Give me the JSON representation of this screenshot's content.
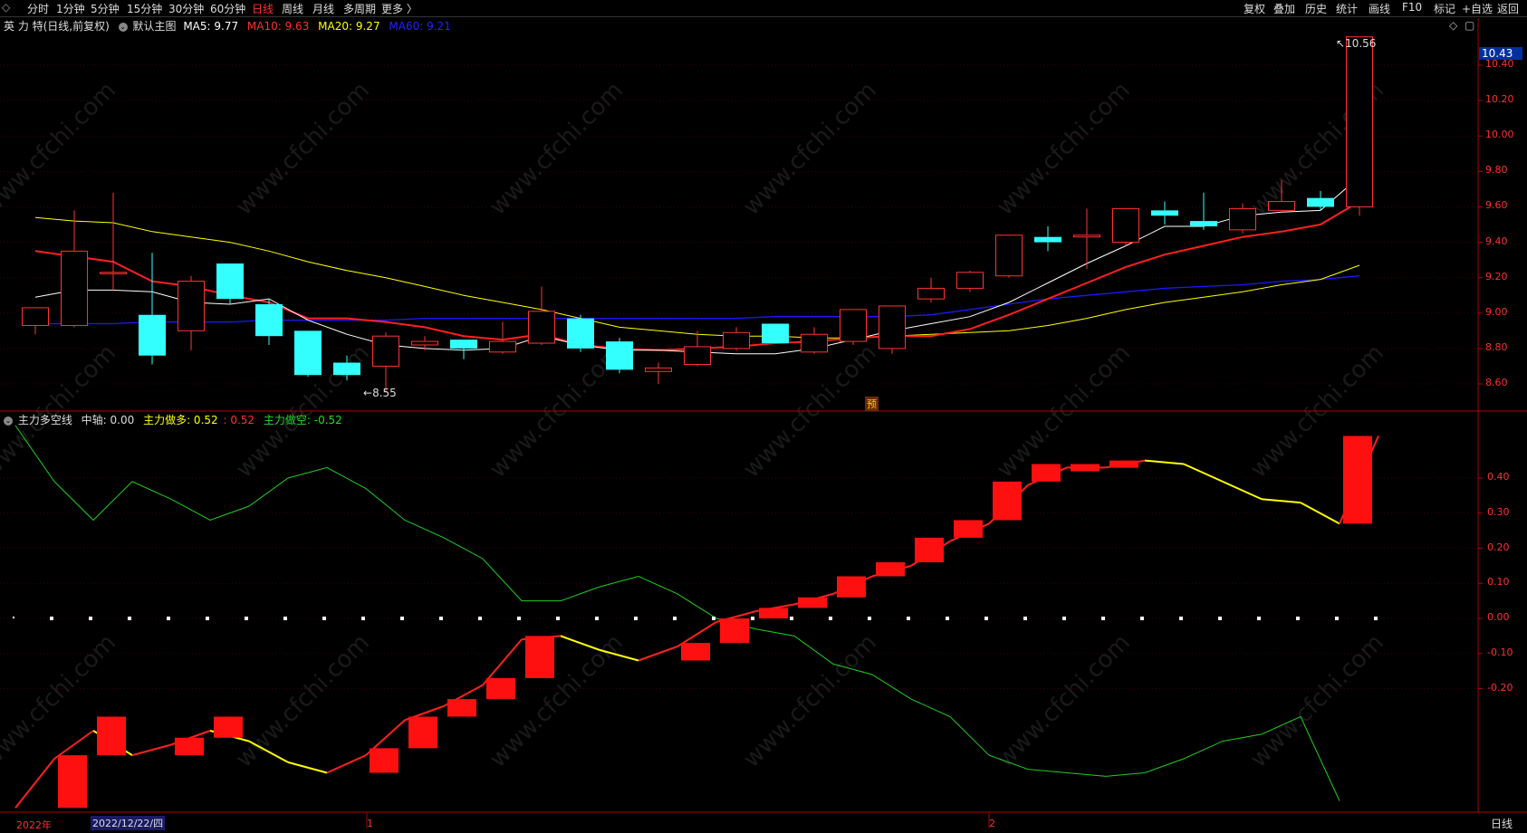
{
  "toolbar": {
    "periods": [
      "分时",
      "1分钟",
      "5分钟",
      "15分钟",
      "30分钟",
      "60分钟",
      "日线",
      "周线",
      "月线",
      "多周期",
      "更多 〉"
    ],
    "active_period": "日线",
    "right_buttons": [
      "复权",
      "叠加",
      "历史",
      "统计",
      "画线",
      "F10",
      "标记",
      "+自选",
      "返回"
    ]
  },
  "colors": {
    "up": "#ff3333",
    "down": "#33ffff",
    "ma5": "#ffffff",
    "ma10": "#ff2020",
    "ma20": "#ffff00",
    "ma60": "#1a1aff",
    "axis": "#b00000",
    "grid": "#3a0000"
  },
  "main_legend": {
    "title": "英 力 特(日线,前复权)",
    "main_label": "默认主图",
    "ma5": "MA5: 9.77",
    "ma10": "MA10: 9.63",
    "ma20": "MA20: 9.27",
    "ma60": "MA60: 9.21"
  },
  "sub_legend": {
    "title": "主力多空线",
    "mid": "中轴: 0.00",
    "long": "主力做多: 0.52",
    "sep": ": 0.52",
    "short": "主力做空: -0.52"
  },
  "price_axis": {
    "ticks": [
      "10.40",
      "10.20",
      "10.00",
      "9.80",
      "9.60",
      "9.40",
      "9.20",
      "9.00",
      "8.80",
      "8.60"
    ],
    "current": "10.43"
  },
  "sub_axis": {
    "ticks": [
      "0.40",
      "0.30",
      "0.20",
      "0.10",
      "0.00",
      "-0.10",
      "-0.20"
    ]
  },
  "date_axis": {
    "labels": [
      "2022年",
      "2022/12/22/四",
      "1",
      "2"
    ],
    "period_label": "日线"
  },
  "annotations": {
    "max_label": "10.56",
    "min_label": "8.55",
    "pre_badge": "预"
  },
  "watermark": "www.cfchi.com",
  "chart_data": [
    {
      "type": "candlestick",
      "title": "英 力 特(日线,前复权)",
      "ylim": [
        8.47,
        10.63
      ],
      "candles": [
        {
          "o": 8.93,
          "h": 9.03,
          "l": 8.88,
          "c": 9.03
        },
        {
          "o": 8.93,
          "h": 9.58,
          "l": 8.92,
          "c": 9.35
        },
        {
          "o": 9.23,
          "h": 9.68,
          "l": 9.13,
          "c": 9.23
        },
        {
          "o": 8.99,
          "h": 9.34,
          "l": 8.71,
          "c": 8.76
        },
        {
          "o": 8.9,
          "h": 9.21,
          "l": 8.79,
          "c": 9.18
        },
        {
          "o": 9.28,
          "h": 9.28,
          "l": 9.05,
          "c": 9.08
        },
        {
          "o": 9.05,
          "h": 9.08,
          "l": 8.82,
          "c": 8.87
        },
        {
          "o": 8.9,
          "h": 8.9,
          "l": 8.64,
          "c": 8.65
        },
        {
          "o": 8.72,
          "h": 8.76,
          "l": 8.62,
          "c": 8.65
        },
        {
          "o": 8.7,
          "h": 8.89,
          "l": 8.55,
          "c": 8.87
        },
        {
          "o": 8.82,
          "h": 8.87,
          "l": 8.79,
          "c": 8.84
        },
        {
          "o": 8.85,
          "h": 8.85,
          "l": 8.74,
          "c": 8.8
        },
        {
          "o": 8.78,
          "h": 8.95,
          "l": 8.77,
          "c": 8.84
        },
        {
          "o": 8.83,
          "h": 9.15,
          "l": 8.82,
          "c": 9.01
        },
        {
          "o": 8.97,
          "h": 8.99,
          "l": 8.78,
          "c": 8.8
        },
        {
          "o": 8.84,
          "h": 8.86,
          "l": 8.66,
          "c": 8.68
        },
        {
          "o": 8.67,
          "h": 8.72,
          "l": 8.6,
          "c": 8.69
        },
        {
          "o": 8.71,
          "h": 8.9,
          "l": 8.7,
          "c": 8.81
        },
        {
          "o": 8.8,
          "h": 8.92,
          "l": 8.79,
          "c": 8.89
        },
        {
          "o": 8.94,
          "h": 8.94,
          "l": 8.83,
          "c": 8.83
        },
        {
          "o": 8.78,
          "h": 8.92,
          "l": 8.77,
          "c": 8.88
        },
        {
          "o": 8.84,
          "h": 9.02,
          "l": 8.82,
          "c": 9.02
        },
        {
          "o": 8.8,
          "h": 9.04,
          "l": 8.77,
          "c": 9.04
        },
        {
          "o": 9.08,
          "h": 9.2,
          "l": 9.06,
          "c": 9.14
        },
        {
          "o": 9.14,
          "h": 9.24,
          "l": 9.12,
          "c": 9.23
        },
        {
          "o": 9.21,
          "h": 9.44,
          "l": 9.2,
          "c": 9.44
        },
        {
          "o": 9.43,
          "h": 9.49,
          "l": 9.35,
          "c": 9.4
        },
        {
          "o": 9.43,
          "h": 9.59,
          "l": 9.25,
          "c": 9.44
        },
        {
          "o": 9.4,
          "h": 9.59,
          "l": 9.38,
          "c": 9.59
        },
        {
          "o": 9.58,
          "h": 9.63,
          "l": 9.5,
          "c": 9.55
        },
        {
          "o": 9.52,
          "h": 9.68,
          "l": 9.47,
          "c": 9.49
        },
        {
          "o": 9.47,
          "h": 9.62,
          "l": 9.45,
          "c": 9.59
        },
        {
          "o": 9.58,
          "h": 9.75,
          "l": 9.57,
          "c": 9.63
        },
        {
          "o": 9.65,
          "h": 9.69,
          "l": 9.58,
          "c": 9.6
        },
        {
          "o": 9.6,
          "h": 10.56,
          "l": 9.55,
          "c": 10.56
        }
      ],
      "ma5": [
        9.09,
        9.13,
        9.13,
        9.12,
        9.06,
        9.05,
        9.08,
        8.96,
        8.88,
        8.82,
        8.8,
        8.79,
        8.8,
        8.87,
        8.82,
        8.79,
        8.79,
        8.78,
        8.77,
        8.77,
        8.8,
        8.85,
        8.9,
        8.94,
        8.98,
        9.06,
        9.17,
        9.28,
        9.38,
        9.49,
        9.49,
        9.55,
        9.57,
        9.58,
        9.77
      ],
      "ma10": [
        9.35,
        9.32,
        9.29,
        9.18,
        9.15,
        9.1,
        9.06,
        8.97,
        8.97,
        8.95,
        8.92,
        8.87,
        8.85,
        8.88,
        8.82,
        8.8,
        8.79,
        8.8,
        8.81,
        8.83,
        8.84,
        8.86,
        8.87,
        8.87,
        8.91,
        8.99,
        9.08,
        9.17,
        9.26,
        9.33,
        9.38,
        9.43,
        9.46,
        9.5,
        9.63
      ],
      "ma20": [
        9.54,
        9.52,
        9.51,
        9.46,
        9.43,
        9.4,
        9.35,
        9.29,
        9.24,
        9.2,
        9.15,
        9.1,
        9.06,
        9.02,
        8.97,
        8.92,
        8.9,
        8.88,
        8.87,
        8.87,
        8.86,
        8.86,
        8.87,
        8.88,
        8.89,
        8.9,
        8.93,
        8.97,
        9.02,
        9.06,
        9.09,
        9.12,
        9.16,
        9.19,
        9.27
      ],
      "ma60": [
        8.94,
        8.94,
        8.94,
        8.95,
        8.95,
        8.95,
        8.96,
        8.96,
        8.96,
        8.96,
        8.97,
        8.97,
        8.97,
        8.97,
        8.97,
        8.97,
        8.97,
        8.97,
        8.97,
        8.98,
        8.98,
        8.98,
        8.98,
        8.99,
        9.02,
        9.05,
        9.08,
        9.1,
        9.12,
        9.14,
        9.15,
        9.16,
        9.18,
        9.19,
        9.21
      ]
    },
    {
      "type": "line",
      "title": "主力多空线",
      "ylim": [
        -0.54,
        0.55
      ],
      "long_line": [
        -0.54,
        -0.4,
        -0.32,
        -0.39,
        -0.36,
        -0.32,
        -0.35,
        -0.41,
        -0.44,
        -0.39,
        -0.29,
        -0.25,
        -0.19,
        -0.06,
        -0.05,
        -0.09,
        -0.12,
        -0.08,
        -0.01,
        0.02,
        0.04,
        0.07,
        0.12,
        0.15,
        0.22,
        0.27,
        0.38,
        0.43,
        0.43,
        0.45,
        0.44,
        0.39,
        0.34,
        0.33,
        0.27,
        0.52
      ],
      "short_line": [
        0.55,
        0.39,
        0.28,
        0.39,
        0.34,
        0.28,
        0.32,
        0.4,
        0.43,
        0.37,
        0.28,
        0.23,
        0.17,
        0.05,
        0.05,
        0.09,
        0.12,
        0.07,
        0.0,
        -0.03,
        -0.05,
        -0.13,
        -0.16,
        -0.23,
        -0.28,
        -0.39,
        -0.43,
        -0.44,
        -0.45,
        -0.44,
        -0.4,
        -0.35,
        -0.33,
        -0.28,
        -0.52
      ],
      "up_bars": [
        {
          "i": 1,
          "from": -0.54,
          "to": -0.39
        },
        {
          "i": 2,
          "from": -0.39,
          "to": -0.28
        },
        {
          "i": 4,
          "from": -0.39,
          "to": -0.34
        },
        {
          "i": 5,
          "from": -0.34,
          "to": -0.28
        },
        {
          "i": 9,
          "from": -0.44,
          "to": -0.37
        },
        {
          "i": 10,
          "from": -0.37,
          "to": -0.28
        },
        {
          "i": 11,
          "from": -0.28,
          "to": -0.23
        },
        {
          "i": 12,
          "from": -0.23,
          "to": -0.17
        },
        {
          "i": 13,
          "from": -0.17,
          "to": -0.05
        },
        {
          "i": 17,
          "from": -0.12,
          "to": -0.07
        },
        {
          "i": 18,
          "from": -0.07,
          "to": 0.0
        },
        {
          "i": 19,
          "from": 0.0,
          "to": 0.03
        },
        {
          "i": 20,
          "from": 0.03,
          "to": 0.06
        },
        {
          "i": 21,
          "from": 0.06,
          "to": 0.12
        },
        {
          "i": 22,
          "from": 0.12,
          "to": 0.16
        },
        {
          "i": 23,
          "from": 0.16,
          "to": 0.23
        },
        {
          "i": 24,
          "from": 0.23,
          "to": 0.28
        },
        {
          "i": 25,
          "from": 0.28,
          "to": 0.39
        },
        {
          "i": 26,
          "from": 0.39,
          "to": 0.44
        },
        {
          "i": 27,
          "from": 0.44,
          "to": 0.44
        },
        {
          "i": 28,
          "from": 0.44,
          "to": 0.45
        },
        {
          "i": 34,
          "from": 0.27,
          "to": 0.52
        }
      ]
    }
  ]
}
